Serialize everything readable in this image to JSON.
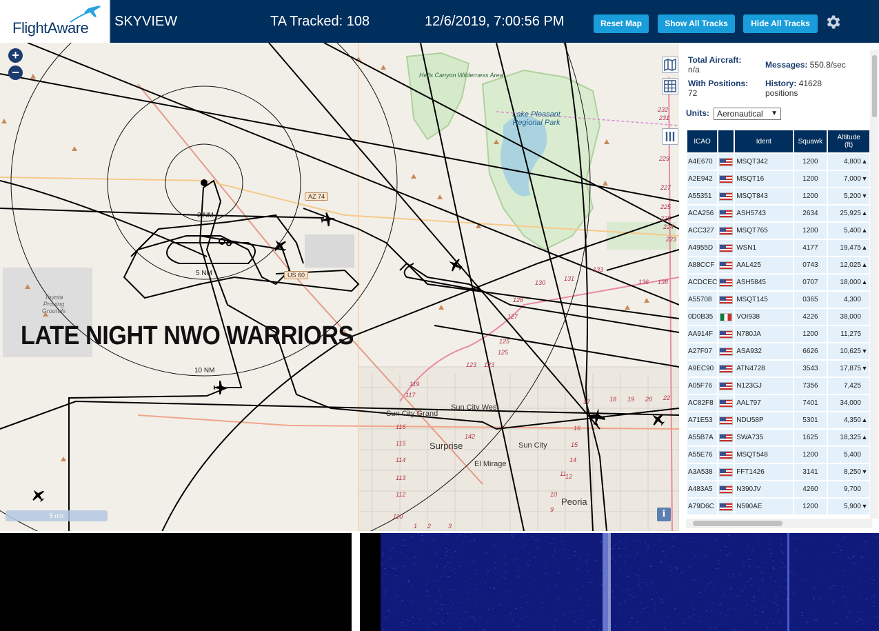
{
  "header": {
    "logo_text": "FlightAware",
    "app_name": "SKYVIEW",
    "ta_tracked": "TA Tracked: 108",
    "datetime": "12/6/2019, 7:00:56 PM",
    "buttons": {
      "reset": "Reset Map",
      "show_all": "Show All Tracks",
      "hide_all": "Hide All Tracks"
    },
    "settings_icon": "gear-icon",
    "colors": {
      "bar": "#002f5d",
      "button": "#199ddb"
    }
  },
  "map": {
    "overlay_text": "LATE NIGHT NWO WARRIORS",
    "zoom_in": "+",
    "zoom_out": "−",
    "scale": "5 nm",
    "info": "i",
    "range_rings": [
      "2 NM",
      "5 NM",
      "10 NM"
    ],
    "places": {
      "hells_canyon": "Hells Canyon Wilderness Area",
      "lake_pleasant": "Lake Pleasant Regional Park",
      "toyota": "Toyota Proving Grounds",
      "sun_city_grand": "Sun City Grand",
      "sun_city_west": "Sun City West",
      "surprise": "Surprise",
      "sun_city": "Sun City",
      "el_mirage": "El Mirage",
      "peoria": "Peoria"
    },
    "shields": {
      "az74": "AZ 74",
      "us60": "US 60"
    },
    "route_numbers": [
      "232",
      "231",
      "229",
      "227",
      "225",
      "224",
      "223",
      "225",
      "133",
      "131",
      "130",
      "136",
      "138",
      "128",
      "127",
      "125",
      "125",
      "123",
      "123",
      "119",
      "117",
      "116",
      "115",
      "114",
      "113",
      "112",
      "110",
      "142",
      "17",
      "18",
      "19",
      "20",
      "22",
      "16",
      "15",
      "14",
      "12",
      "11",
      "10",
      "9",
      "1",
      "2",
      "3"
    ]
  },
  "panel": {
    "total_aircraft_label": "Total Aircraft:",
    "total_aircraft_value": "n/a",
    "with_positions_label": "With Positions:",
    "with_positions_value": "72",
    "messages_label": "Messages:",
    "messages_value": "550.8/sec",
    "history_label": "History:",
    "history_value": "41628",
    "history_unit": "positions",
    "units_label": "Units:",
    "units_value": "Aeronautical",
    "table": {
      "headers": {
        "icao": "ICAO",
        "ident": "Ident",
        "squawk": "Squawk",
        "altitude": "Altitude",
        "altitude_unit": "(ft)"
      },
      "rows": [
        {
          "icao": "A4E670",
          "flag": "us",
          "ident": "MSQT342",
          "squawk": "1200",
          "alt": "4,800",
          "trend": "▲"
        },
        {
          "icao": "A2E942",
          "flag": "us",
          "ident": "MSQT16",
          "squawk": "1200",
          "alt": "7,000",
          "trend": "▼"
        },
        {
          "icao": "A55351",
          "flag": "us",
          "ident": "MSQT843",
          "squawk": "1200",
          "alt": "5,200",
          "trend": "▼"
        },
        {
          "icao": "ACA256",
          "flag": "us",
          "ident": "ASH5743",
          "squawk": "2634",
          "alt": "25,925",
          "trend": "▲"
        },
        {
          "icao": "ACC327",
          "flag": "us",
          "ident": "MSQT765",
          "squawk": "1200",
          "alt": "5,400",
          "trend": "▲"
        },
        {
          "icao": "A4955D",
          "flag": "us",
          "ident": "WSN1",
          "squawk": "4177",
          "alt": "19,475",
          "trend": "▲"
        },
        {
          "icao": "A88CCF",
          "flag": "us",
          "ident": "AAL425",
          "squawk": "0743",
          "alt": "12,025",
          "trend": "▲"
        },
        {
          "icao": "ACDCEC",
          "flag": "us",
          "ident": "ASH5845",
          "squawk": "0707",
          "alt": "18,000",
          "trend": "▲"
        },
        {
          "icao": "A55708",
          "flag": "us",
          "ident": "MSQT145",
          "squawk": "0365",
          "alt": "4,300",
          "trend": ""
        },
        {
          "icao": "0D0B35",
          "flag": "mx",
          "ident": "VOI938",
          "squawk": "4226",
          "alt": "38,000",
          "trend": ""
        },
        {
          "icao": "AA914F",
          "flag": "us",
          "ident": "N780JA",
          "squawk": "1200",
          "alt": "11,275",
          "trend": ""
        },
        {
          "icao": "A27F07",
          "flag": "us",
          "ident": "ASA932",
          "squawk": "6626",
          "alt": "10,625",
          "trend": "▼"
        },
        {
          "icao": "A9EC90",
          "flag": "us",
          "ident": "ATN4728",
          "squawk": "3543",
          "alt": "17,875",
          "trend": "▼"
        },
        {
          "icao": "A05F76",
          "flag": "us",
          "ident": "N123GJ",
          "squawk": "7356",
          "alt": "7,425",
          "trend": ""
        },
        {
          "icao": "AC82F8",
          "flag": "us",
          "ident": "AAL797",
          "squawk": "7401",
          "alt": "34,000",
          "trend": ""
        },
        {
          "icao": "A71E53",
          "flag": "us",
          "ident": "NDU58P",
          "squawk": "5301",
          "alt": "4,350",
          "trend": "▲"
        },
        {
          "icao": "A55B7A",
          "flag": "us",
          "ident": "SWA735",
          "squawk": "1625",
          "alt": "18,325",
          "trend": "▲"
        },
        {
          "icao": "A55E76",
          "flag": "us",
          "ident": "MSQT548",
          "squawk": "1200",
          "alt": "5,400",
          "trend": ""
        },
        {
          "icao": "A3A538",
          "flag": "us",
          "ident": "FFT1426",
          "squawk": "3141",
          "alt": "8,250",
          "trend": "▼"
        },
        {
          "icao": "A483A5",
          "flag": "us",
          "ident": "N390JV",
          "squawk": "4260",
          "alt": "9,700",
          "trend": ""
        },
        {
          "icao": "A79D6C",
          "flag": "us",
          "ident": "N590AE",
          "squawk": "1200",
          "alt": "5,900",
          "trend": "▼"
        }
      ]
    }
  }
}
